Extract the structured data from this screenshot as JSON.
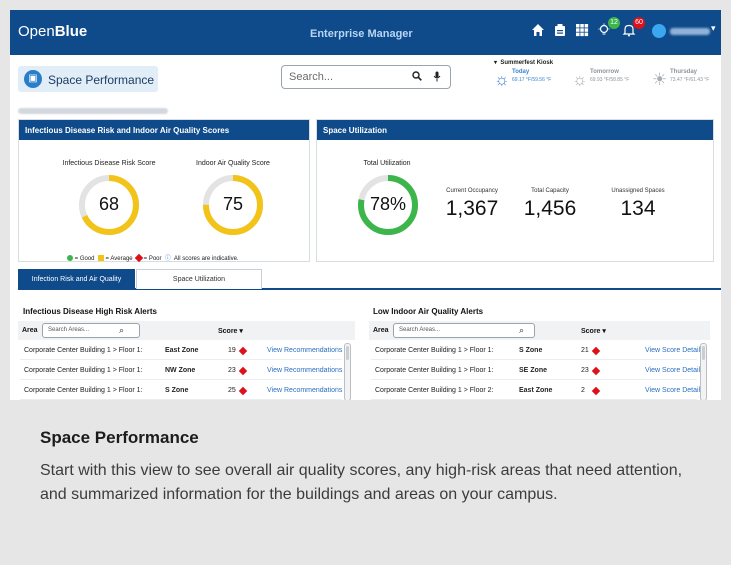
{
  "topbar": {
    "brand_prefix": "Open",
    "brand_suffix": "Blue",
    "app_title": "Enterprise Manager",
    "lightbulb_badge": "12",
    "bell_badge": "60"
  },
  "header": {
    "page_title": "Space Performance",
    "search_placeholder": "Search...",
    "kiosk_label": "Summerfest Kiosk",
    "weather": [
      {
        "day": "Today",
        "temps": "69.17 °F/59.56 °F"
      },
      {
        "day": "Tomorrow",
        "temps": "69.93 °F/58.85 °F"
      },
      {
        "day": "Thursday",
        "temps": "73.47 °F/61.43 °F"
      }
    ]
  },
  "scores_card": {
    "title": "Infectious Disease Risk and Indoor Air Quality Scores",
    "infectious_label": "Infectious Disease Risk Score",
    "infectious_value": "68",
    "iaq_label": "Indoor Air Quality Score",
    "iaq_value": "75",
    "legend_good": "= Good",
    "legend_average": "= Average",
    "legend_poor": "= Poor",
    "legend_note": "All scores are indicative."
  },
  "utilization_card": {
    "title": "Space Utilization",
    "total_label": "Total Utilization",
    "total_value": "78%",
    "total_fraction": 0.78,
    "occupancy_label": "Current Occupancy",
    "occupancy_value": "1,367",
    "capacity_label": "Total Capacity",
    "capacity_value": "1,456",
    "unassigned_label": "Unassigned Spaces",
    "unassigned_value": "134"
  },
  "tabs": {
    "tab1": "Infection Risk and Air Quality",
    "tab2": "Space Utilization"
  },
  "left_table": {
    "title": "Infectious Disease High Risk Alerts",
    "area_header": "Area",
    "search_placeholder": "Search Areas...",
    "score_header": "Score",
    "rows": [
      {
        "area": "Corporate Center Building 1 > Floor 1:",
        "zone": "East Zone",
        "score": "19",
        "action": "View Recommendations"
      },
      {
        "area": "Corporate Center Building 1 > Floor 1:",
        "zone": "NW Zone",
        "score": "23",
        "action": "View Recommendations"
      },
      {
        "area": "Corporate Center Building 1 > Floor 1:",
        "zone": "S Zone",
        "score": "25",
        "action": "View Recommendations"
      }
    ]
  },
  "right_table": {
    "title": "Low Indoor Air Quality Alerts",
    "area_header": "Area",
    "search_placeholder": "Search Areas...",
    "score_header": "Score",
    "rows": [
      {
        "area": "Corporate Center Building 1 > Floor 1:",
        "zone": "S Zone",
        "score": "21",
        "action": "View Score Details"
      },
      {
        "area": "Corporate Center Building 1 > Floor 1:",
        "zone": "SE Zone",
        "score": "23",
        "action": "View Score Details"
      },
      {
        "area": "Corporate Center Building 1 > Floor 2:",
        "zone": "East Zone",
        "score": "2",
        "action": "View Score Details"
      }
    ]
  },
  "caption": {
    "title": "Space Performance",
    "body": "Start with this view to see overall air quality scores, any high-risk areas that need attention, and summarized information for the buildings and areas on your campus."
  },
  "colors": {
    "nav": "#0f4a8a",
    "good": "#3cb54a",
    "average": "#f2c318",
    "poor": "#e0101b",
    "link": "#2a6fc0"
  }
}
